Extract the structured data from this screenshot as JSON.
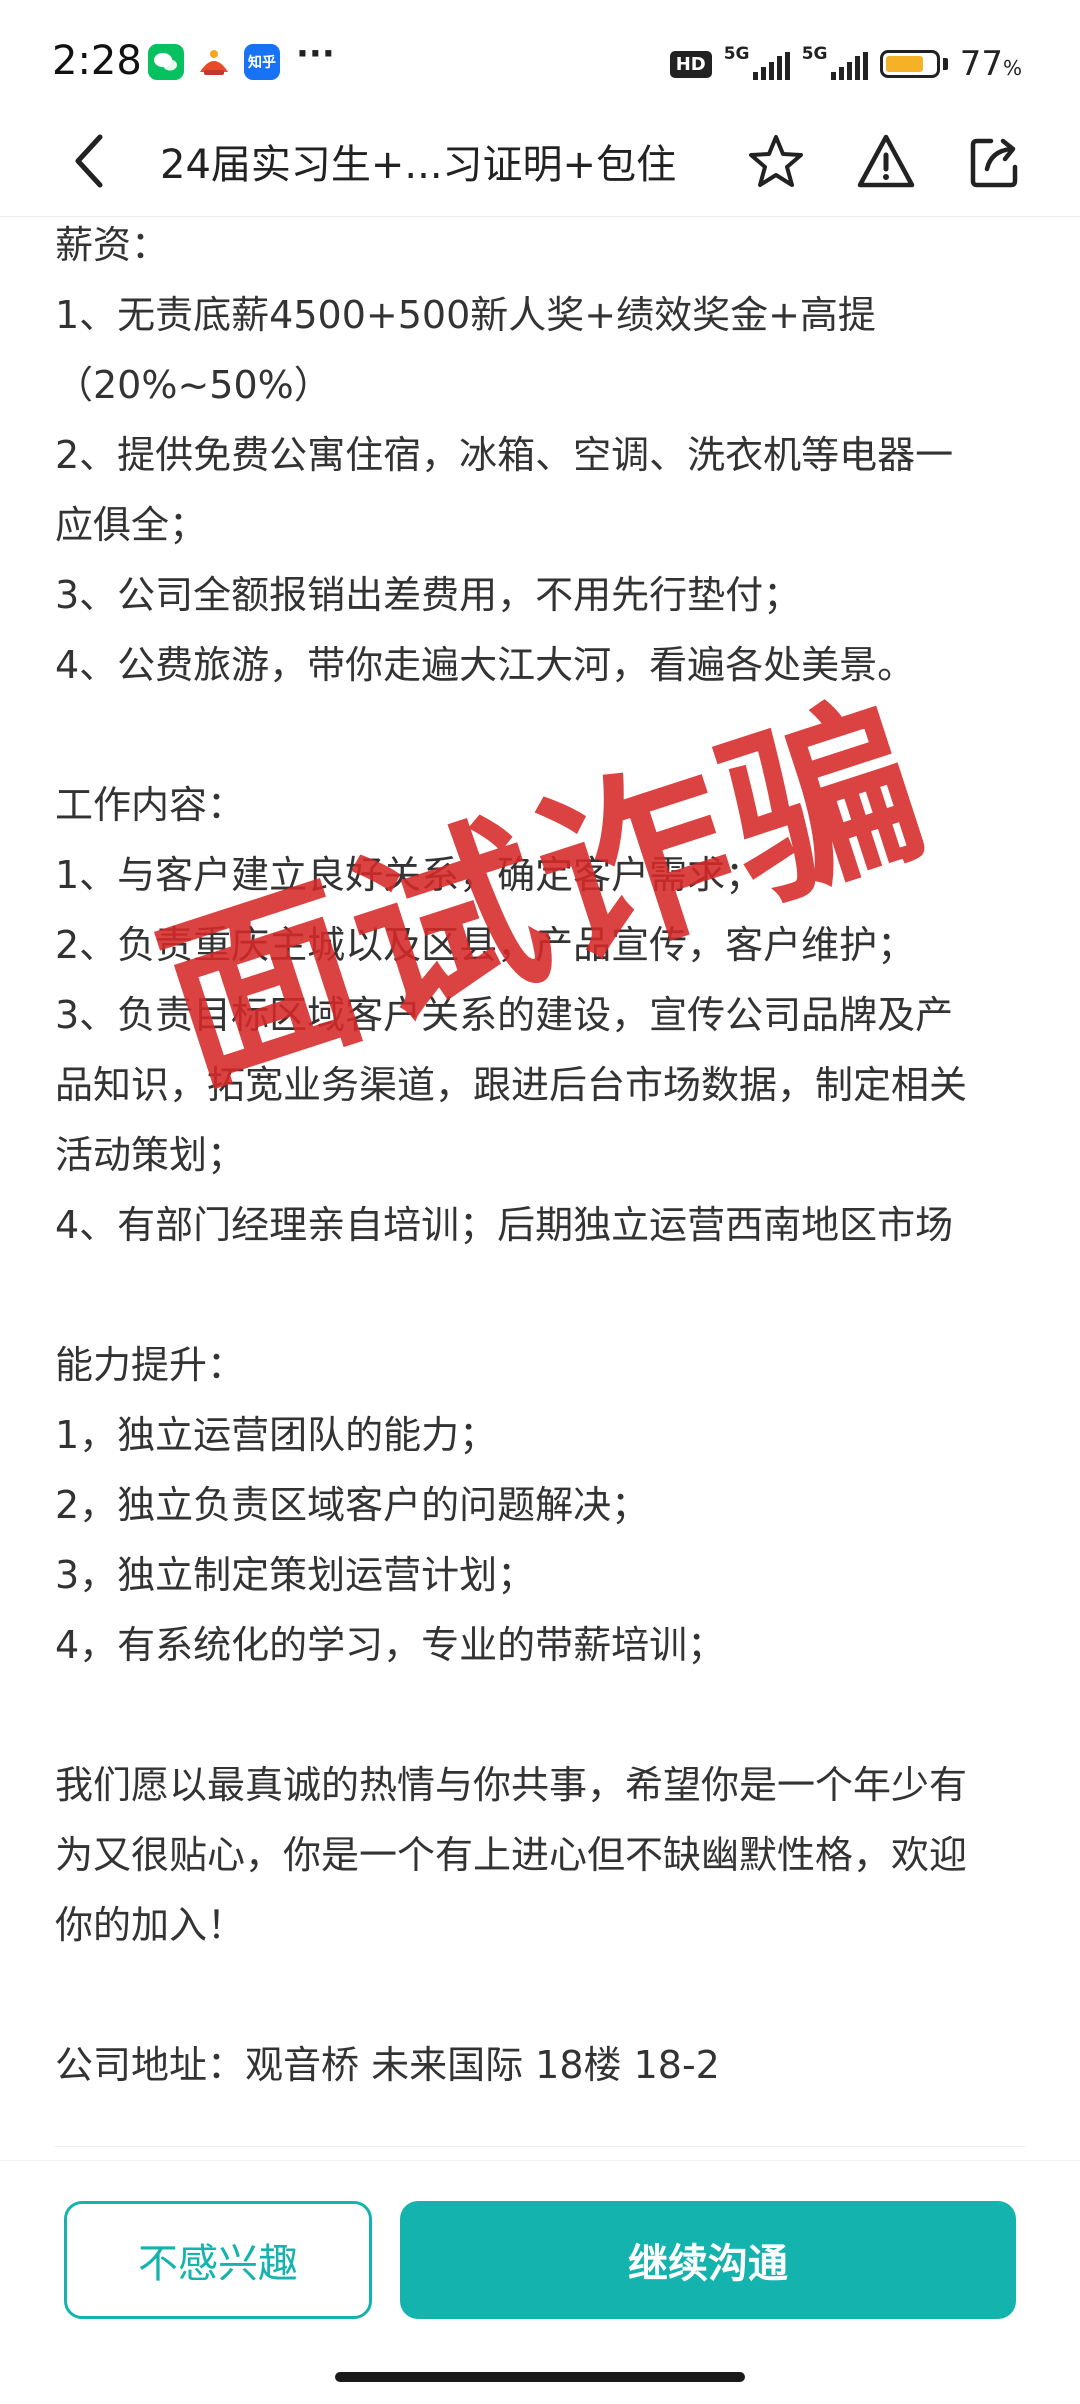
{
  "status_bar": {
    "time": "2:28",
    "zhihu_label": "知乎",
    "more": "···",
    "hd_badge": "HD",
    "signal_label": "5G",
    "battery_percent": 77,
    "battery_text": "77",
    "battery_unit": "%",
    "battery_color": "#f6b227"
  },
  "header": {
    "back_icon": "chevron-left-icon",
    "title": "24届实习生+...习证明+包住",
    "icons": [
      "star-icon",
      "warning-icon",
      "share-icon"
    ]
  },
  "content": {
    "salary": {
      "heading": "薪资：",
      "lines": [
        "1、无责底薪4500+500新人奖+绩效奖金+高提",
        "（20%~50%）",
        "2、提供免费公寓住宿，冰箱、空调、洗衣机等电器一",
        "应俱全；",
        "3、公司全额报销出差费用，不用先行垫付；",
        "4、公费旅游，带你走遍大江大河，看遍各处美景。"
      ]
    },
    "work": {
      "heading": "工作内容：",
      "lines": [
        "1、与客户建立良好关系，确定客户需求；",
        "2、负责重庆主城以及区县，产品宣传，客户维护；",
        "3、负责目标区域客户关系的建设，宣传公司品牌及产",
        "品知识，拓宽业务渠道，跟进后台市场数据，制定相关",
        "活动策划；",
        "4、有部门经理亲自培训；后期独立运营西南地区市场"
      ]
    },
    "ability": {
      "heading": "能力提升：",
      "lines": [
        "1，独立运营团队的能力；",
        "2，独立负责区域客户的问题解决；",
        "3，独立制定策划运营计划；",
        "4，有系统化的学习，专业的带薪培训；"
      ]
    },
    "closing": {
      "lines": [
        "我们愿以最真诚的热情与你共事，希望你是一个年少有",
        "为又很贴心，你是一个有上进心但不缺幽默性格，欢迎",
        "你的加入！"
      ]
    },
    "address": "公司地址：观音桥 未来国际 18楼 18-2"
  },
  "watermark": "面试诈骗",
  "buttons": {
    "not_interested": "不感兴趣",
    "continue_chat": "继续沟通"
  },
  "colors": {
    "accent": "#15b3ad",
    "watermark": "#d62828"
  }
}
